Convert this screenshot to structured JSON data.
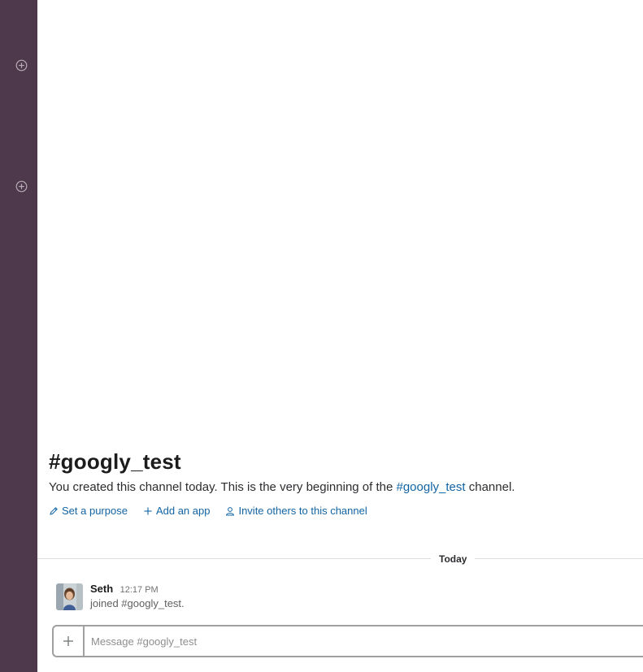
{
  "sidebar": {
    "add_icons": [
      "plus-circle-icon",
      "plus-circle-icon"
    ],
    "background": "#4d394b"
  },
  "channel": {
    "title": "#googly_test",
    "intro_prefix": "You created this channel today. This is the very beginning of the ",
    "intro_link": "#googly_test",
    "intro_suffix": " channel."
  },
  "actions": {
    "set_purpose": "Set a purpose",
    "add_app": "Add an app",
    "invite": "Invite others to this channel"
  },
  "divider": {
    "label": "Today"
  },
  "messages": [
    {
      "author": "Seth",
      "time": "12:17 PM",
      "text": "joined #googly_test."
    }
  ],
  "composer": {
    "placeholder": "Message #googly_test",
    "value": ""
  },
  "colors": {
    "link": "#1264a3",
    "sidebar": "#4d394b"
  }
}
